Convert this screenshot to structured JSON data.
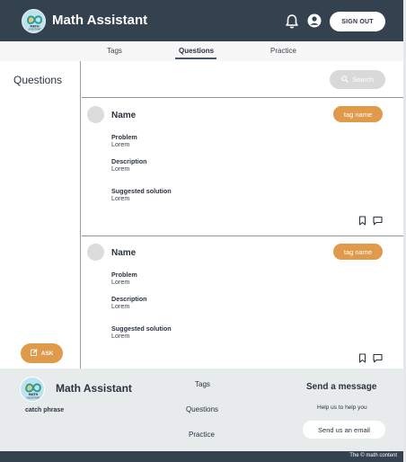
{
  "header": {
    "app_title": "Math Assistant",
    "logo_text": "MATH\nASSISTANT",
    "signout_label": "SIGN OUT"
  },
  "tabs": [
    {
      "label": "Tags",
      "active": false
    },
    {
      "label": "Questions",
      "active": true
    },
    {
      "label": "Practice",
      "active": false
    }
  ],
  "sidebar": {
    "title": "Questions",
    "ask_label": "ASK"
  },
  "search": {
    "label": "Search"
  },
  "questions": [
    {
      "name": "Name",
      "tag": "tag name",
      "problem_label": "Problem",
      "problem": "Lorem",
      "description_label": "Description",
      "description": "Lorem",
      "solution_label": "Suggested solution",
      "solution": "Lorem"
    },
    {
      "name": "Name",
      "tag": "tag name",
      "problem_label": "Problem",
      "problem": "Lorem",
      "description_label": "Description",
      "description": "Lorem",
      "solution_label": "Suggested solution",
      "solution": "Lorem"
    }
  ],
  "footer": {
    "title": "Math Assistant",
    "catch_phrase": "catch phrase",
    "links": [
      "Tags",
      "Questions",
      "Practice"
    ],
    "send_title": "Send  a message",
    "help_text": "Help us to help you",
    "email_label": "Send us an email"
  },
  "copyright": "The © math content",
  "colors": {
    "header_bg": "#34414f",
    "accent": "#e09a4b",
    "footer_bg": "#e7ebec"
  }
}
